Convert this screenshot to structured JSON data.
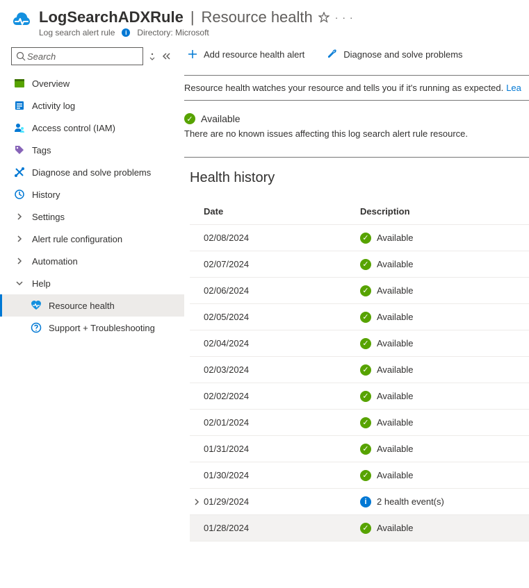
{
  "header": {
    "resource_name": "LogSearchADXRule",
    "blade_title": "Resource health",
    "resource_type": "Log search alert rule",
    "directory_label": "Directory: Microsoft"
  },
  "search": {
    "placeholder": "Search"
  },
  "nav": {
    "overview": "Overview",
    "activity_log": "Activity log",
    "access_control": "Access control (IAM)",
    "tags": "Tags",
    "diagnose": "Diagnose and solve problems",
    "history": "History",
    "settings": "Settings",
    "alert_rule_config": "Alert rule configuration",
    "automation": "Automation",
    "help": "Help",
    "resource_health": "Resource health",
    "support": "Support + Troubleshooting"
  },
  "toolbar": {
    "add_alert": "Add resource health alert",
    "diagnose": "Diagnose and solve problems"
  },
  "banner": {
    "text": "Resource health watches your resource and tells you if it's running as expected.",
    "link": "Lea"
  },
  "status": {
    "label": "Available",
    "message": "There are no known issues affecting this log search alert rule resource."
  },
  "history": {
    "title": "Health history",
    "col_date": "Date",
    "col_desc": "Description",
    "rows": [
      {
        "date": "02/08/2024",
        "type": "ok",
        "desc": "Available"
      },
      {
        "date": "02/07/2024",
        "type": "ok",
        "desc": "Available"
      },
      {
        "date": "02/06/2024",
        "type": "ok",
        "desc": "Available"
      },
      {
        "date": "02/05/2024",
        "type": "ok",
        "desc": "Available"
      },
      {
        "date": "02/04/2024",
        "type": "ok",
        "desc": "Available"
      },
      {
        "date": "02/03/2024",
        "type": "ok",
        "desc": "Available"
      },
      {
        "date": "02/02/2024",
        "type": "ok",
        "desc": "Available"
      },
      {
        "date": "02/01/2024",
        "type": "ok",
        "desc": "Available"
      },
      {
        "date": "01/31/2024",
        "type": "ok",
        "desc": "Available"
      },
      {
        "date": "01/30/2024",
        "type": "ok",
        "desc": "Available"
      },
      {
        "date": "01/29/2024",
        "type": "info",
        "desc": "2 health event(s)",
        "expand": true
      },
      {
        "date": "01/28/2024",
        "type": "ok",
        "desc": "Available",
        "hover": true
      }
    ]
  }
}
